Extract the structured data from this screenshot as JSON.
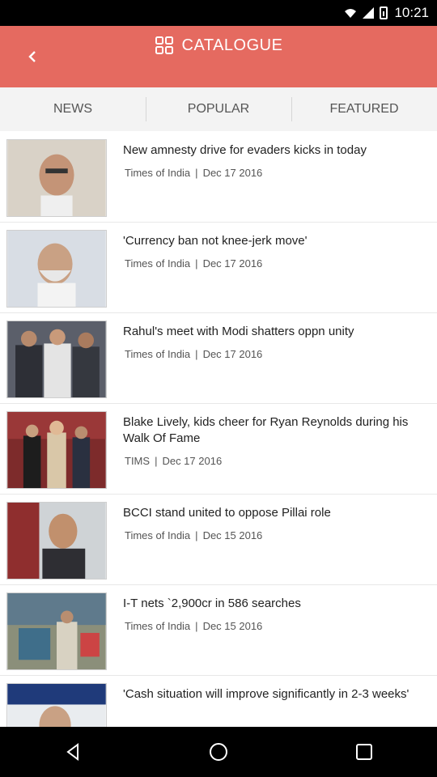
{
  "status": {
    "time": "10:21"
  },
  "header": {
    "title": "CATALOGUE",
    "back_icon": "back-arrow-icon",
    "title_icon": "grid-icon"
  },
  "tabs": [
    {
      "label": "NEWS"
    },
    {
      "label": "POPULAR"
    },
    {
      "label": "FEATURED"
    }
  ],
  "articles": [
    {
      "headline": "New amnesty drive for evaders kicks in today",
      "source": "Times of India",
      "sep": "|",
      "date": "Dec 17 2016"
    },
    {
      "headline": "'Currency ban not knee-jerk move'",
      "source": "Times of India",
      "sep": "|",
      "date": "Dec 17 2016"
    },
    {
      "headline": "Rahul's meet with Modi shatters oppn unity",
      "source": "Times of India",
      "sep": "|",
      "date": "Dec 17 2016"
    },
    {
      "headline": "Blake Lively, kids cheer for Ryan Reynolds during his Walk Of Fame",
      "source": "TIMS",
      "sep": "|",
      "date": "Dec 17 2016"
    },
    {
      "headline": "BCCI stand united to oppose Pillai role",
      "source": "Times of India",
      "sep": "|",
      "date": "Dec 15 2016"
    },
    {
      "headline": "I-T nets `2,900cr in 586 searches",
      "source": "Times of India",
      "sep": "|",
      "date": "Dec 15 2016"
    },
    {
      "headline": "'Cash situation will improve significantly in 2-3 weeks'",
      "source": "",
      "sep": "",
      "date": ""
    }
  ],
  "nav": {
    "back": "nav-back-icon",
    "home": "nav-home-icon",
    "recents": "nav-recents-icon"
  }
}
